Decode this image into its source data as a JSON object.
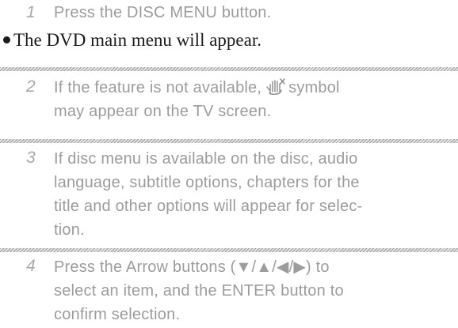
{
  "steps": [
    {
      "number": "1",
      "lines": [
        "Press the DISC MENU button."
      ]
    },
    {
      "number": "2",
      "lines": [
        "If the feature is not available,",
        "symbol",
        "may appear on the TV screen."
      ]
    },
    {
      "number": "3",
      "lines": [
        "If disc menu is available on the disc, audio",
        "language, subtitle options, chapters for the",
        "title and other options will appear for selec-",
        "tion."
      ]
    },
    {
      "number": "4",
      "lines": [
        "Press the Arrow buttons (▼/▲/◀/▶) to",
        "select an item, and the ENTER button to",
        "confirm selection."
      ]
    }
  ],
  "result_text": "The DVD main menu will appear.",
  "icons": {
    "not_available": "prohibited-hand-icon"
  },
  "colors": {
    "step_text": "#9c9c9c",
    "result_text": "#1a1a1a"
  }
}
